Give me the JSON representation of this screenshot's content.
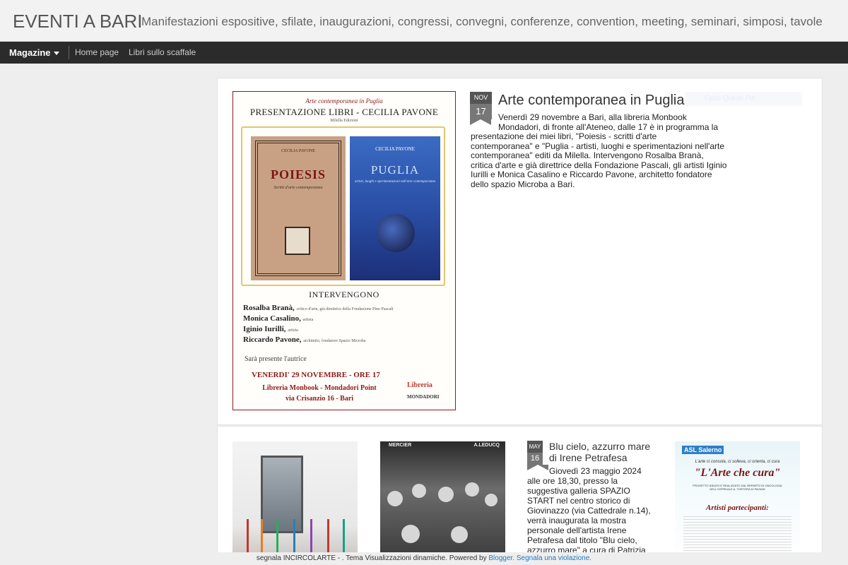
{
  "header": {
    "title": "EVENTI A BARI",
    "description": "Manifestazioni espositive, sfilate, inaugurazioni, congressi, convegni, conferenze, convention, meeting, seminari, simposi, tavole"
  },
  "nav": {
    "magazine": "Magazine",
    "links": [
      "Home page",
      "Libri sullo scaffale"
    ]
  },
  "main_post": {
    "date": {
      "month": "NOV",
      "day": "17"
    },
    "title": "Arte contemporanea in Puglia",
    "body_lines": [
      "Venerdì 29 novembre a Bari, alla libreria Monbook",
      "Mondadori, di fronte all'Ateneo, dalle 17 è in programma la",
      "presentazione dei miei libri, \"Poiesis - scritti d'arte",
      "contemporanea\" e \"Puglia - artisti, luoghi e sperimentazioni nell'arte",
      "contemporanea\" editi da Milella. Intervengono Rosalba Branà,",
      "critica d'arte e già direttrice della Fondazione Pascali, gli artisti Iginio",
      "Iurilli e Monica Casalino e Riccardo Pavone, architetto fondatore",
      "dello spazio Microba a Bari."
    ],
    "ghost_label": "Fatto Questi Pin",
    "poster": {
      "top_line": "Arte contemporanea in Puglia",
      "heading": "PRESENTAZIONE LIBRI - CECILIA PAVONE",
      "publisher": "Milella Edizioni",
      "book1": {
        "author": "CECILIA PAVONE",
        "title": "POIESIS",
        "subtitle": "Scritti d'arte contemporanea"
      },
      "book2": {
        "author": "CECILIA PAVONE",
        "title": "PUGLIA",
        "subtitle": "artisti, luoghi e sperimentazioni nell'arte contemporanea"
      },
      "intervengono": "INTERVENGONO",
      "speakers": [
        {
          "name": "Rosalba Branà,",
          "role": "critico d'arte, già direttrice della Fondazione Pino Pascali"
        },
        {
          "name": "Monica Casalino,",
          "role": "artista"
        },
        {
          "name": "Iginio Iurilli,",
          "role": "artista"
        },
        {
          "name": "Riccardo Pavone,",
          "role": "architetto, fondatore Spazio Microba"
        }
      ],
      "presente": "Sarà presente l'autrice",
      "date_line": "VENERDI' 29 NOVEMBRE  - ORE 17",
      "place_line1": "Libreria Monbook - Mondadori Point",
      "place_line2": "via Crisanzio 16 - Bari",
      "lib_logo": "Libreria",
      "lib_logo2": "MONDADORI"
    }
  },
  "second_post": {
    "date": {
      "month": "MAY",
      "day": "16"
    },
    "title_lines": [
      "Blu cielo, azzurro mare",
      "di Irene Petrafesa"
    ],
    "body_lines": [
      "Giovedì 23 maggio 2024",
      "alle ore 18,30, presso la",
      "suggestiva galleria SPAZIO",
      "START nel centro storico di",
      "Giovinazzo (via Cattedrale n.14),",
      "verrà inaugurata la mostra",
      "personale dell'artista Irene",
      "Petrafesa dal titolo  \"Blu cielo,",
      "azzurro mare\" a cura di Patrizia"
    ]
  },
  "thumbs": {
    "t2_caption_left": "MERCIER",
    "t2_caption_right": "A.LEDUCQ",
    "t3": {
      "asl": "ASL Salerno",
      "motto": "L'arte ci consola, ci solleva, ci orienta, ci cura",
      "big": "\"L'Arte che cura\"",
      "small": "PROGETTO IDEATO E REALIZZATO DAL REPARTO DI ONCOLOGIA DELL'OSPEDALE A. TORTORA DI PAGANI",
      "artisti": "Artisti partecipanti:"
    }
  },
  "footer": {
    "text": "segnala INCIRCOLARTE - . Tema Visualizzazioni dinamiche. Powered by",
    "blogger": "Blogger.",
    "report": "Segnala una violazione."
  }
}
